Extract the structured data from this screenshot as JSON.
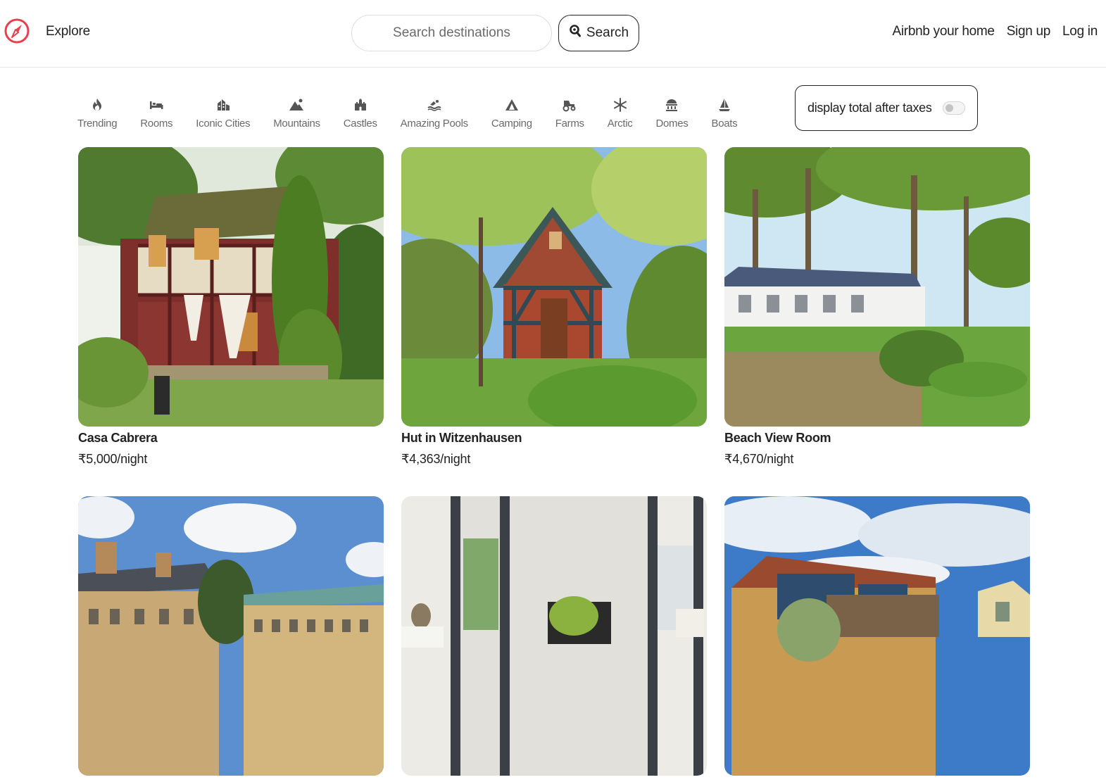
{
  "header": {
    "logo_icon": "compass-icon",
    "brand_color": "#e8404f",
    "explore_label": "Explore",
    "search_placeholder": "Search destinations",
    "search_button_label": "Search",
    "links": {
      "host": "Airbnb your home",
      "signup": "Sign up",
      "login": "Log in"
    }
  },
  "categories": [
    {
      "label": "Trending",
      "icon": "fire-icon"
    },
    {
      "label": "Rooms",
      "icon": "bed-icon"
    },
    {
      "label": "Iconic Cities",
      "icon": "city-icon"
    },
    {
      "label": "Mountains",
      "icon": "mountain-icon"
    },
    {
      "label": "Castles",
      "icon": "castle-icon"
    },
    {
      "label": "Amazing Pools",
      "icon": "pool-icon"
    },
    {
      "label": "Camping",
      "icon": "tent-icon"
    },
    {
      "label": "Farms",
      "icon": "tractor-icon"
    },
    {
      "label": "Arctic",
      "icon": "snowflake-icon"
    },
    {
      "label": "Domes",
      "icon": "dome-icon"
    },
    {
      "label": "Boats",
      "icon": "sailboat-icon"
    }
  ],
  "tax_toggle": {
    "label": "display total after taxes",
    "enabled": false
  },
  "listings": [
    {
      "title": "Casa Cabrera",
      "price": "₹5,000/night",
      "image": "half-timbered cottage with ivy"
    },
    {
      "title": "Hut in Witzenhausen",
      "price": "₹4,363/night",
      "image": "brick timber hut in garden"
    },
    {
      "title": "Beach View Room",
      "price": "₹4,670/night",
      "image": "palm trees and cottages"
    },
    {
      "title": "",
      "price": "",
      "image": "stone college buildings"
    },
    {
      "title": "",
      "price": "",
      "image": "white brick interior living room"
    },
    {
      "title": "",
      "price": "",
      "image": "modern house with blue sky"
    }
  ]
}
